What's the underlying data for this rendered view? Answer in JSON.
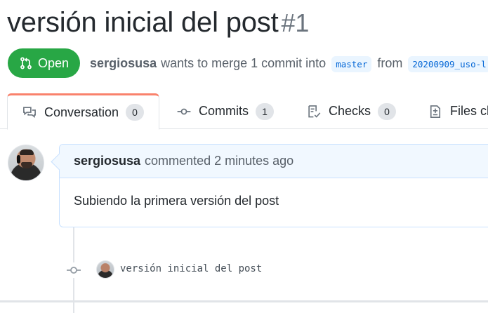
{
  "pull_request": {
    "title": "versión inicial del post",
    "number": "#1",
    "state": "Open",
    "author": "sergiosusa",
    "merge_text": "wants to merge 1 commit into",
    "base_branch": "master",
    "from_text": "from",
    "head_branch": "20200909_uso-l"
  },
  "tabs": [
    {
      "label": "Conversation",
      "count": "0",
      "icon": "comment-discussion-icon",
      "selected": true
    },
    {
      "label": "Commits",
      "count": "1",
      "icon": "git-commit-icon",
      "selected": false
    },
    {
      "label": "Checks",
      "count": "0",
      "icon": "checklist-icon",
      "selected": false
    },
    {
      "label": "Files ch",
      "icon": "file-diff-icon",
      "selected": false
    }
  ],
  "comment": {
    "author": "sergiosusa",
    "action": "commented 2 minutes ago",
    "body": "Subiendo la primera versión del post"
  },
  "commit": {
    "message": "versión inicial del post"
  },
  "colors": {
    "open_green": "#28a745",
    "link_blue": "#0366d6",
    "tab_accent": "#f9826c",
    "comment_border": "#c8e1ff",
    "comment_header_bg": "#f1f8ff"
  }
}
